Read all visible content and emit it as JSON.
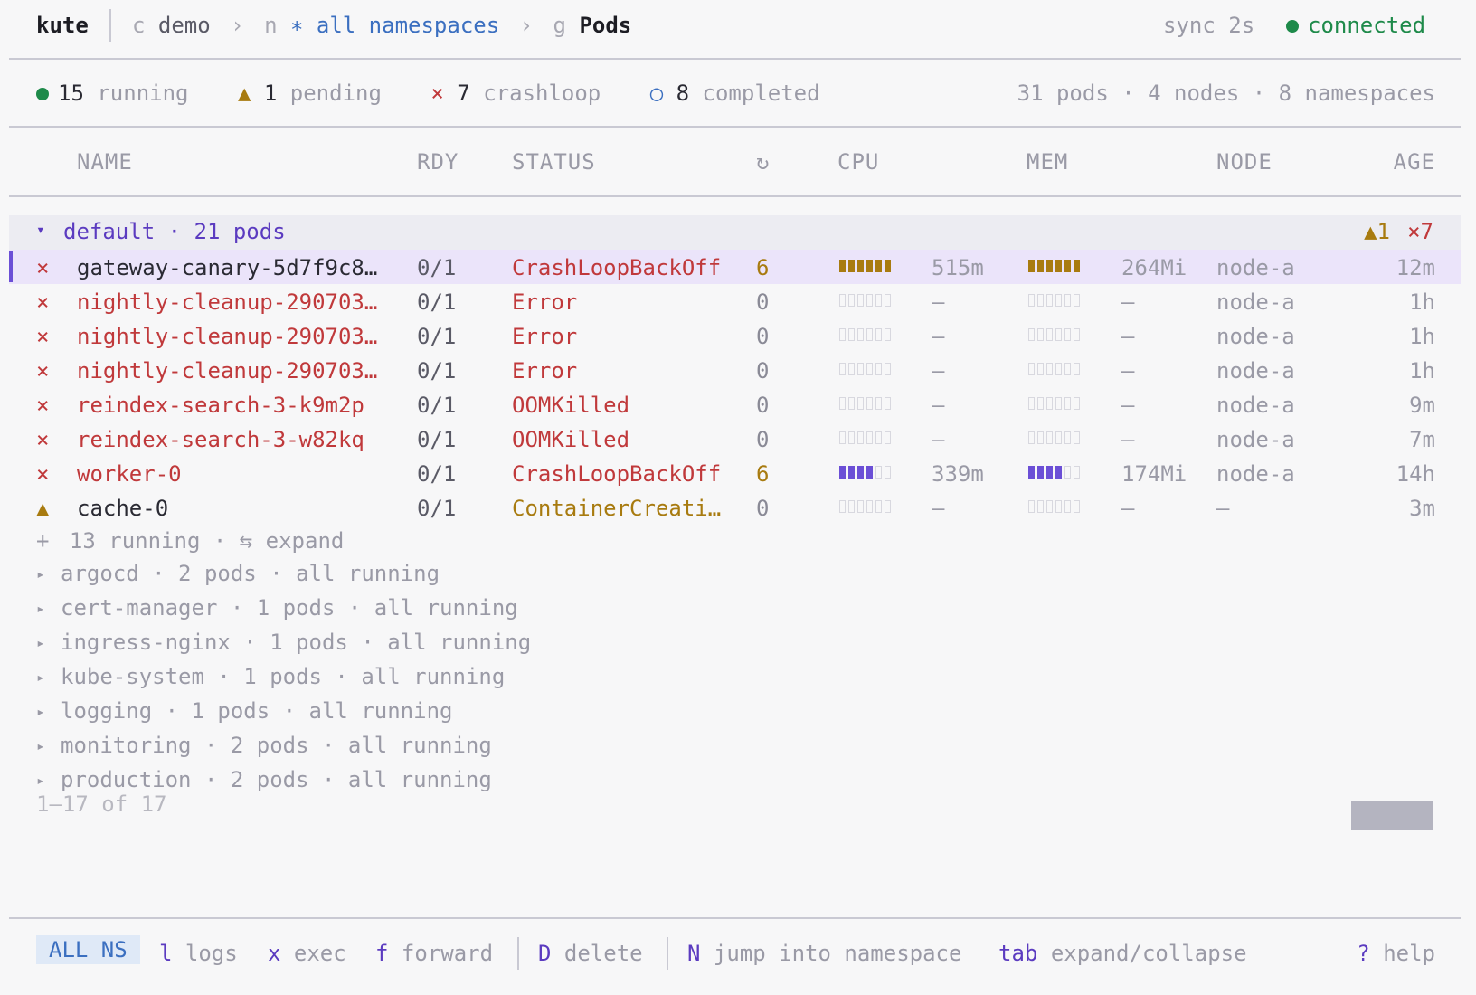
{
  "app": {
    "brand": "kute"
  },
  "breadcrumb": {
    "context_key": "c",
    "context": "demo",
    "namespace_key": "n",
    "namespace_star": "∗",
    "namespace": "all namespaces",
    "resource_key": "g",
    "resource": "Pods",
    "sep": "›"
  },
  "status": {
    "sync": "sync 2s",
    "connection": "connected"
  },
  "summary": {
    "running_count": "15",
    "running_label": "running",
    "pending_count": "1",
    "pending_label": "pending",
    "crashloop_count": "7",
    "crashloop_label": "crashloop",
    "completed_count": "8",
    "completed_label": "completed",
    "totals": "31 pods · 4 nodes · 8 namespaces"
  },
  "columns": {
    "name": "NAME",
    "rdy": "RDY",
    "status": "STATUS",
    "restarts": "↻",
    "cpu": "CPU",
    "mem": "MEM",
    "node": "NODE",
    "age": "AGE"
  },
  "group_default": {
    "chevron": "▾",
    "label": "default · 21 pods",
    "badge_pending": "▲1",
    "badge_crash": "×7"
  },
  "pods": [
    {
      "icon": "×",
      "name": "gateway-canary-5d7f9c8…",
      "rdy": "0/1",
      "status": "CrashLoopBackOff",
      "restarts": "6",
      "cpu": "515m",
      "cpu_level": 6,
      "mem": "264Mi",
      "mem_level": 6,
      "node": "node-a",
      "age": "12m"
    },
    {
      "icon": "×",
      "name": "nightly-cleanup-290703…",
      "rdy": "0/1",
      "status": "Error",
      "restarts": "0",
      "cpu": "–",
      "cpu_level": 0,
      "mem": "–",
      "mem_level": 0,
      "node": "node-a",
      "age": "1h"
    },
    {
      "icon": "×",
      "name": "nightly-cleanup-290703…",
      "rdy": "0/1",
      "status": "Error",
      "restarts": "0",
      "cpu": "–",
      "cpu_level": 0,
      "mem": "–",
      "mem_level": 0,
      "node": "node-a",
      "age": "1h"
    },
    {
      "icon": "×",
      "name": "nightly-cleanup-290703…",
      "rdy": "0/1",
      "status": "Error",
      "restarts": "0",
      "cpu": "–",
      "cpu_level": 0,
      "mem": "–",
      "mem_level": 0,
      "node": "node-a",
      "age": "1h"
    },
    {
      "icon": "×",
      "name": "reindex-search-3-k9m2p",
      "rdy": "0/1",
      "status": "OOMKilled",
      "restarts": "0",
      "cpu": "–",
      "cpu_level": 0,
      "mem": "–",
      "mem_level": 0,
      "node": "node-a",
      "age": "9m"
    },
    {
      "icon": "×",
      "name": "reindex-search-3-w82kq",
      "rdy": "0/1",
      "status": "OOMKilled",
      "restarts": "0",
      "cpu": "–",
      "cpu_level": 0,
      "mem": "–",
      "mem_level": 0,
      "node": "node-a",
      "age": "7m"
    },
    {
      "icon": "×",
      "name": "worker-0",
      "rdy": "0/1",
      "status": "CrashLoopBackOff",
      "restarts": "6",
      "cpu": "339m",
      "cpu_level": 4,
      "mem": "174Mi",
      "mem_level": 4,
      "node": "node-a",
      "age": "14h"
    },
    {
      "icon": "▲",
      "name": "cache-0",
      "rdy": "0/1",
      "status": "ContainerCreati…",
      "restarts": "0",
      "cpu": "–",
      "cpu_level": 0,
      "mem": "–",
      "mem_level": 0,
      "node": "–",
      "age": "3m"
    }
  ],
  "expand_row": {
    "plus": "+",
    "text": "13 running · ⇆ expand"
  },
  "namespaces": [
    {
      "chevron": "▸",
      "label": "argocd · 2 pods · all running"
    },
    {
      "chevron": "▸",
      "label": "cert-manager · 1 pods · all running"
    },
    {
      "chevron": "▸",
      "label": "ingress-nginx · 1 pods · all running"
    },
    {
      "chevron": "▸",
      "label": "kube-system · 1 pods · all running"
    },
    {
      "chevron": "▸",
      "label": "logging · 1 pods · all running"
    },
    {
      "chevron": "▸",
      "label": "monitoring · 2 pods · all running"
    },
    {
      "chevron": "▸",
      "label": "production · 2 pods · all running"
    }
  ],
  "pagination": "1–17 of 17",
  "footer": {
    "mode": "ALL NS",
    "logs_key": "l",
    "logs": "logs",
    "exec_key": "x",
    "exec": "exec",
    "forward_key": "f",
    "forward": "forward",
    "delete_key": "D",
    "delete": "delete",
    "jump_key": "N",
    "jump": "jump into namespace",
    "tab_key": "tab",
    "tab": "expand/collapse",
    "help_key": "?",
    "help": "help"
  },
  "colors": {
    "running": "#1e8a4a",
    "pending": "#a87b10",
    "error": "#c0393b",
    "accent": "#5b3bc0",
    "link": "#3b6fc0"
  }
}
